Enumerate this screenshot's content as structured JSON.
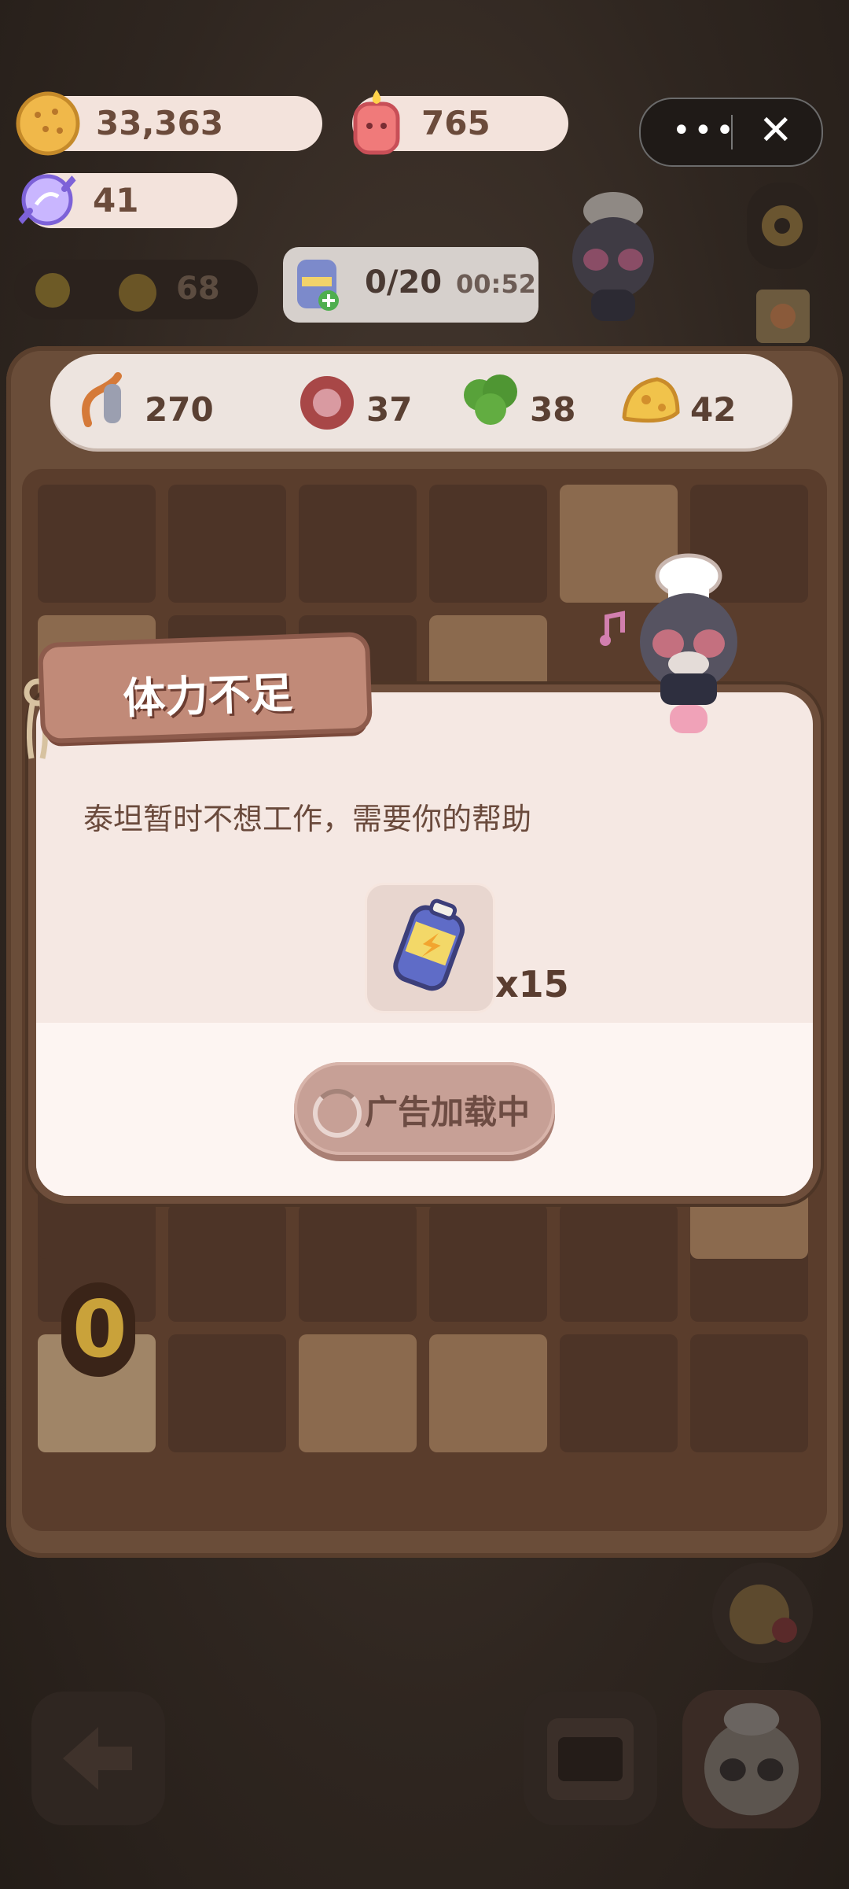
{
  "currencies": {
    "coins": "33,363",
    "gems": "765",
    "candy": "41"
  },
  "miniprogram": {
    "more": "•••",
    "close": "✕"
  },
  "status": {
    "sun_level": "68",
    "orders": "0/20",
    "timer": "00:52"
  },
  "ingredients": [
    {
      "name": "flour-sugar",
      "count": "270"
    },
    {
      "name": "meat",
      "count": "37"
    },
    {
      "name": "broccoli",
      "count": "38"
    },
    {
      "name": "cheese",
      "count": "42"
    }
  ],
  "board_item_value": "0",
  "dialog": {
    "title": "体力不足",
    "message": "泰坦暂时不想工作，需要你的帮助",
    "reward_qty": "x15",
    "ad_button": "广告加载中"
  },
  "colors": {
    "accent": "#c18a78",
    "panel": "#f5e8e3",
    "board": "#6a4d39"
  }
}
